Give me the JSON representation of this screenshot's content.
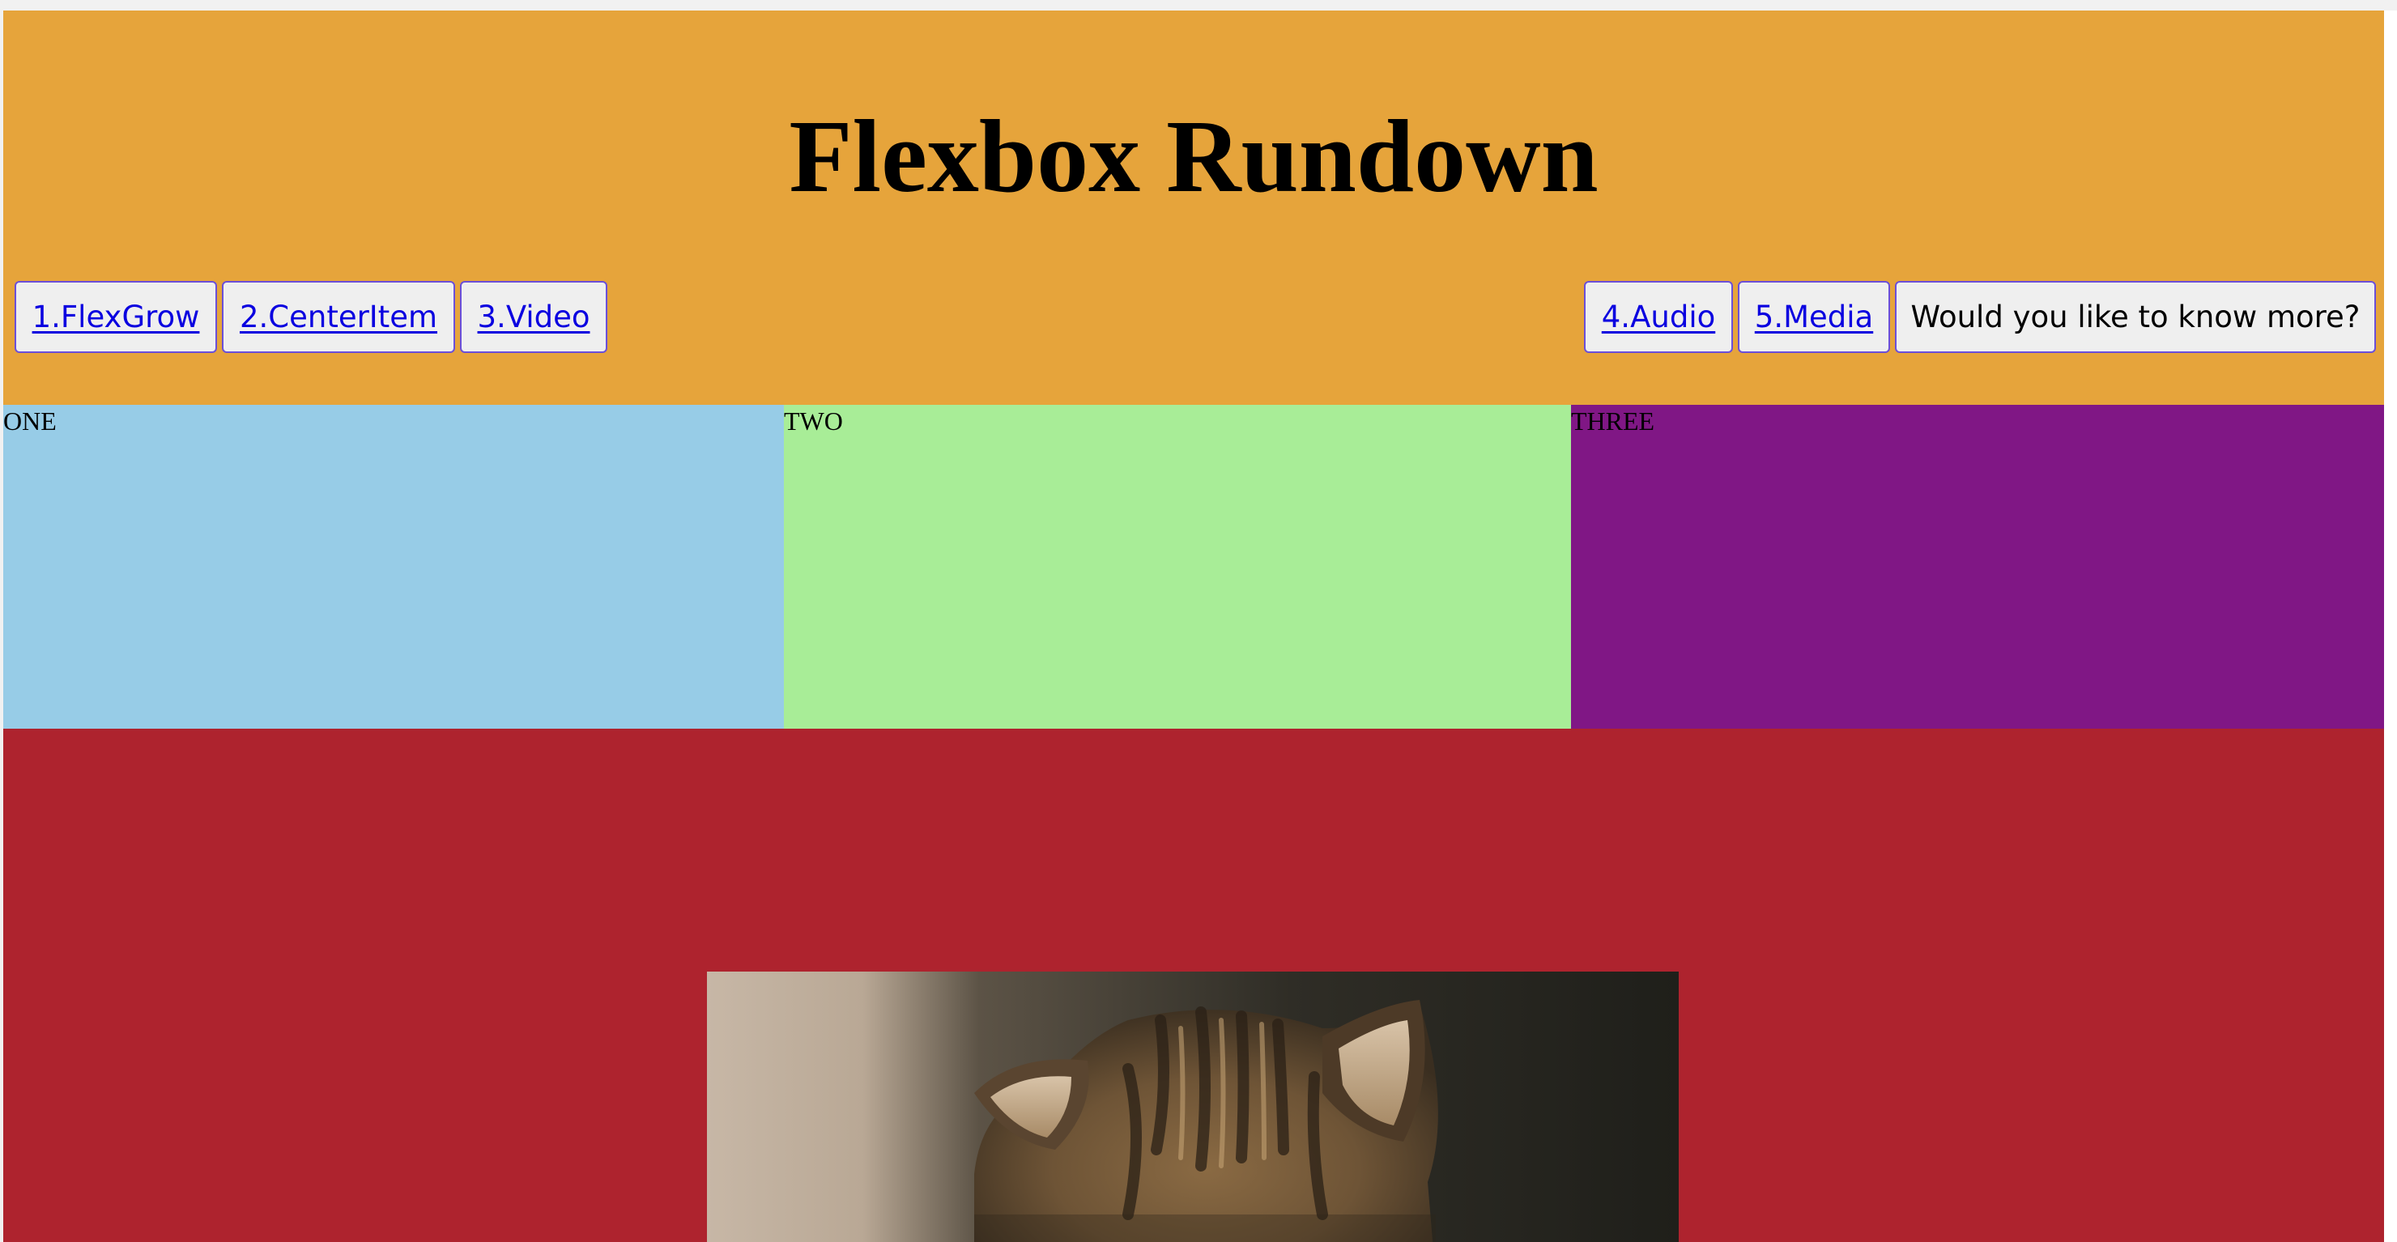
{
  "header": {
    "title": "Flexbox Rundown",
    "bg_color": "#e6a43b"
  },
  "nav": {
    "left_items": [
      {
        "label": "1.FlexGrow"
      },
      {
        "label": "2.CenterItem"
      },
      {
        "label": "3.Video"
      }
    ],
    "right_items": [
      {
        "label": "4.Audio"
      },
      {
        "label": "5.Media"
      }
    ],
    "cta_label": "Would you like to know more?",
    "link_color": "#0a00e0",
    "button_border_color": "#6b4fd9"
  },
  "boxes": [
    {
      "label": "ONE",
      "color": "#97cce7"
    },
    {
      "label": "TWO",
      "color": "#a8ed97"
    },
    {
      "label": "THREE",
      "color": "#801785"
    }
  ],
  "media": {
    "bg_color": "#ae232e",
    "image_icon": "kitten-photo"
  }
}
